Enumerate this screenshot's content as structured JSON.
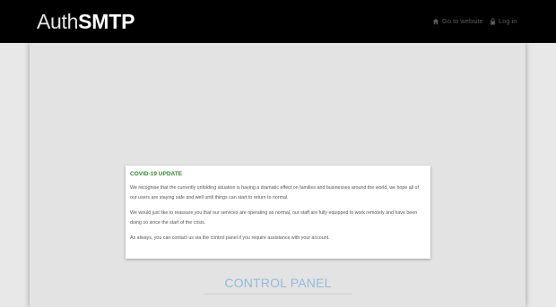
{
  "header": {
    "logo_light": "Auth",
    "logo_bold": "SMTP",
    "nav": {
      "home_label": "Go to website",
      "login_label": "Log in",
      "home_icon": "home-icon",
      "login_icon": "lock-icon"
    }
  },
  "notice": {
    "title": "COVID-19 UPDATE",
    "paragraphs": [
      "We recognise that the currently unfolding situation is having a dramatic effect on families and businesses around the world, we hope all of our users are staying safe and well until things can start to return to normal.",
      "We would just like to reassure you that our services are operating as normal, our staff are fully equipped to work remotely and have been doing so since the start of the crisis.",
      "As always, you can contact us via the control panel if you require assistance with your account."
    ]
  },
  "main": {
    "heading": "CONTROL PANEL"
  },
  "colors": {
    "header_bg": "#000000",
    "page_bg": "#e3e3e3",
    "notice_title": "#2e8b2e",
    "heading": "#8fbcd9"
  }
}
